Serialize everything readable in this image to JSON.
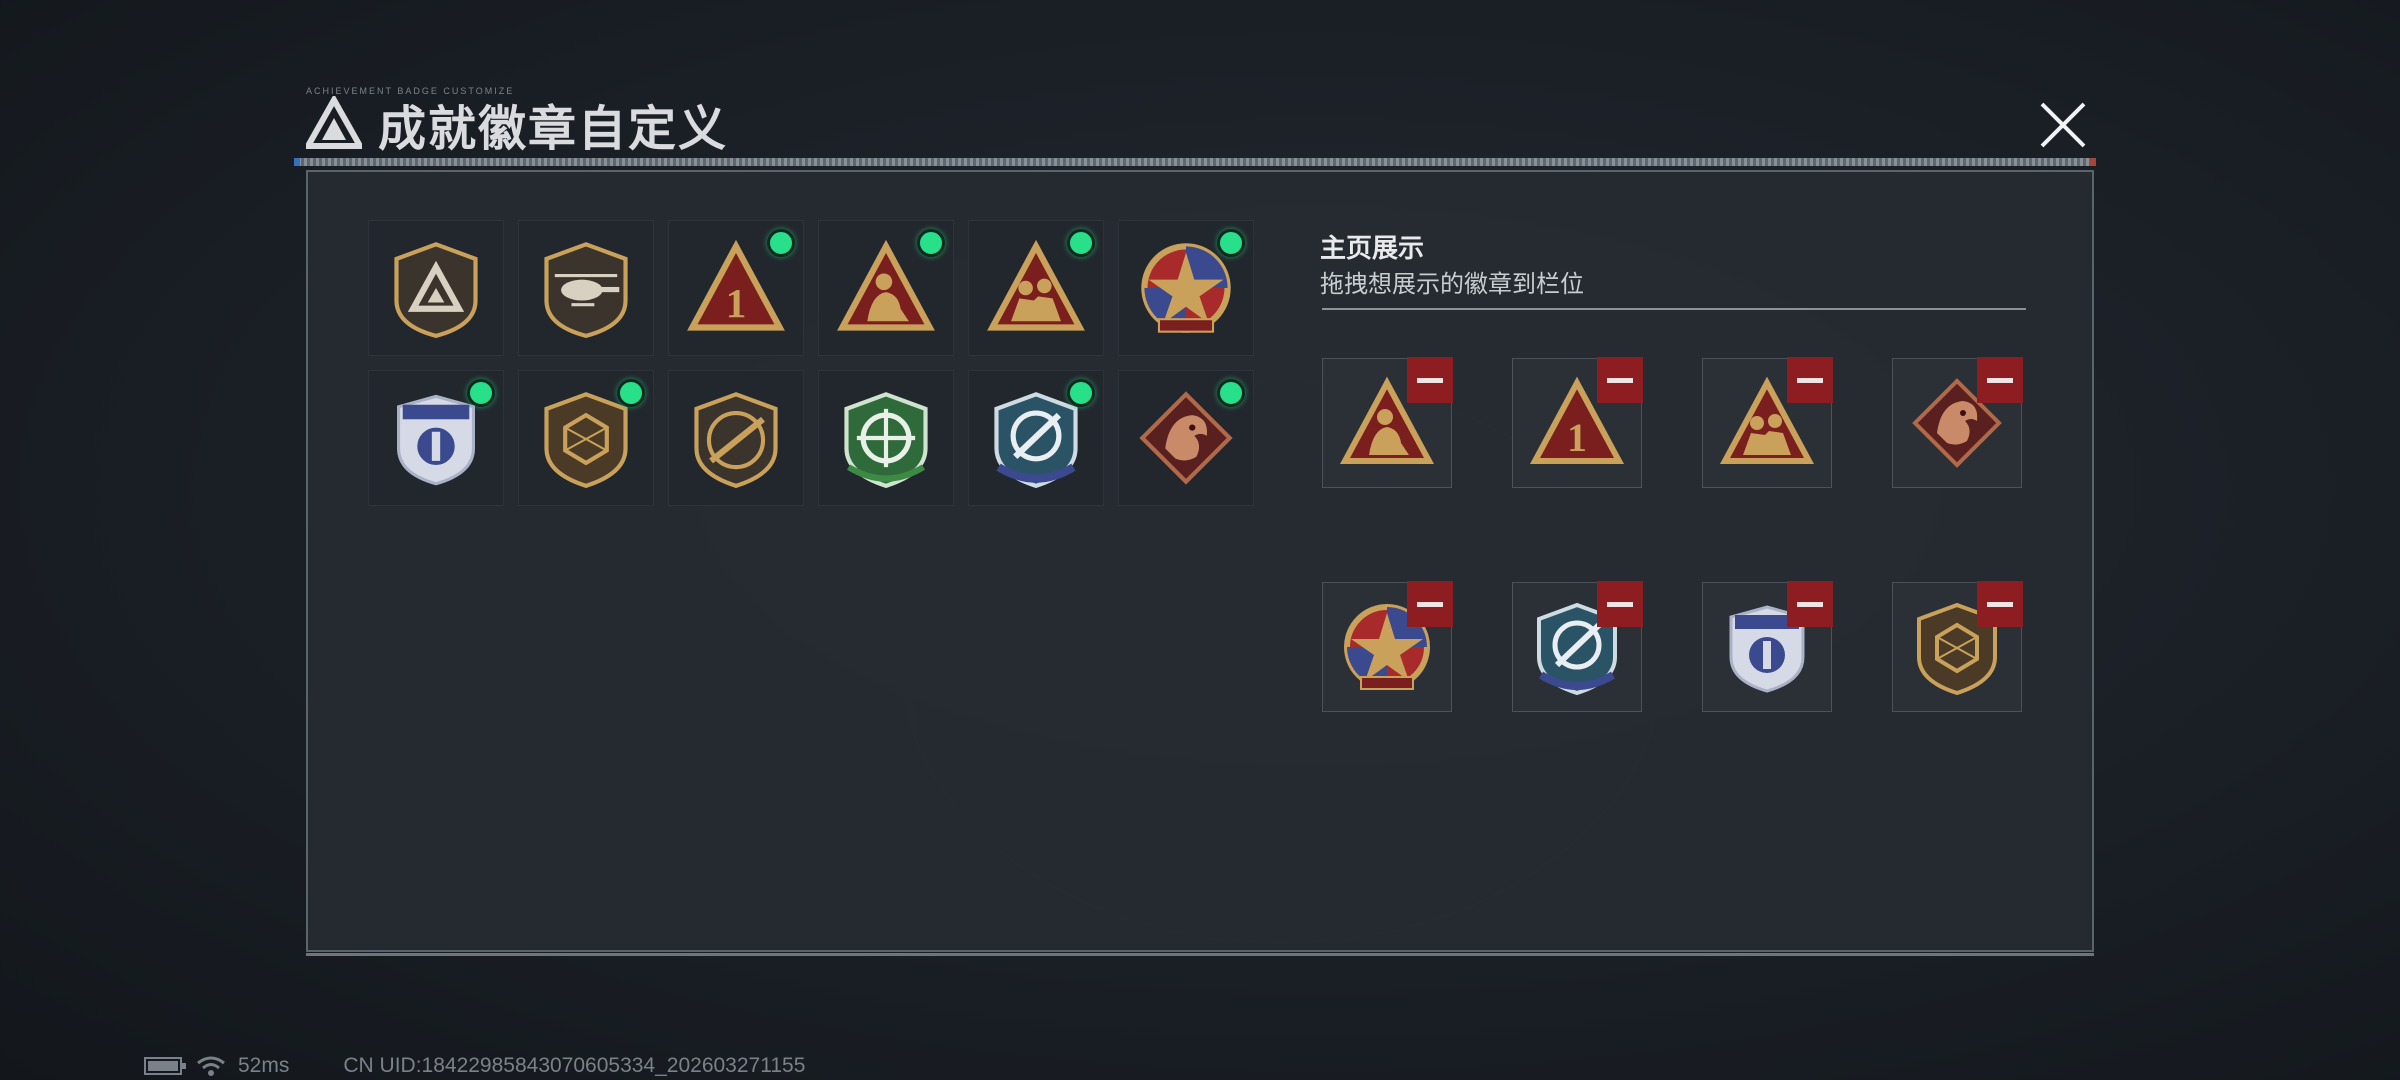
{
  "header": {
    "title": "成就徽章自定义",
    "sub_text": "ACHIEVEMENT BADGE CUSTOMIZE"
  },
  "badge_grid": [
    {
      "icon": "triangle-logo-badge-icon",
      "equipped": false
    },
    {
      "icon": "helicopter-badge-icon",
      "equipped": false
    },
    {
      "icon": "number-one-triangle-badge-icon",
      "equipped": true
    },
    {
      "icon": "soldier-triangle-badge-icon",
      "equipped": true
    },
    {
      "icon": "squad-triangle-badge-icon",
      "equipped": true
    },
    {
      "icon": "star-medal-badge-icon",
      "equipped": true
    },
    {
      "icon": "blue-shield-badge-icon",
      "equipped": true
    },
    {
      "icon": "gem-shield-badge-icon",
      "equipped": true
    },
    {
      "icon": "rifle-badge-icon",
      "equipped": false
    },
    {
      "icon": "green-crosshair-badge-icon",
      "equipped": false
    },
    {
      "icon": "blue-crosshair-badge-icon",
      "equipped": true
    },
    {
      "icon": "dragon-badge-icon",
      "equipped": true
    }
  ],
  "showcase": {
    "title": "主页展示",
    "subtitle": "拖拽想展示的徽章到栏位",
    "slots": [
      {
        "icon": "soldier-triangle-badge-icon"
      },
      {
        "icon": "number-one-triangle-badge-icon"
      },
      {
        "icon": "squad-triangle-badge-icon"
      },
      {
        "icon": "dragon-badge-icon"
      },
      {
        "icon": "star-medal-badge-icon"
      },
      {
        "icon": "blue-crosshair-badge-icon"
      },
      {
        "icon": "blue-shield-badge-icon"
      },
      {
        "icon": "gem-shield-badge-icon"
      }
    ]
  },
  "status_bar": {
    "ping": "52ms",
    "uid": "CN UID:18422985843070605334_202603271155"
  },
  "colors": {
    "equipped_dot": "#28e08a",
    "remove_button": "#8e1d22",
    "gold": "#c9a15a"
  }
}
